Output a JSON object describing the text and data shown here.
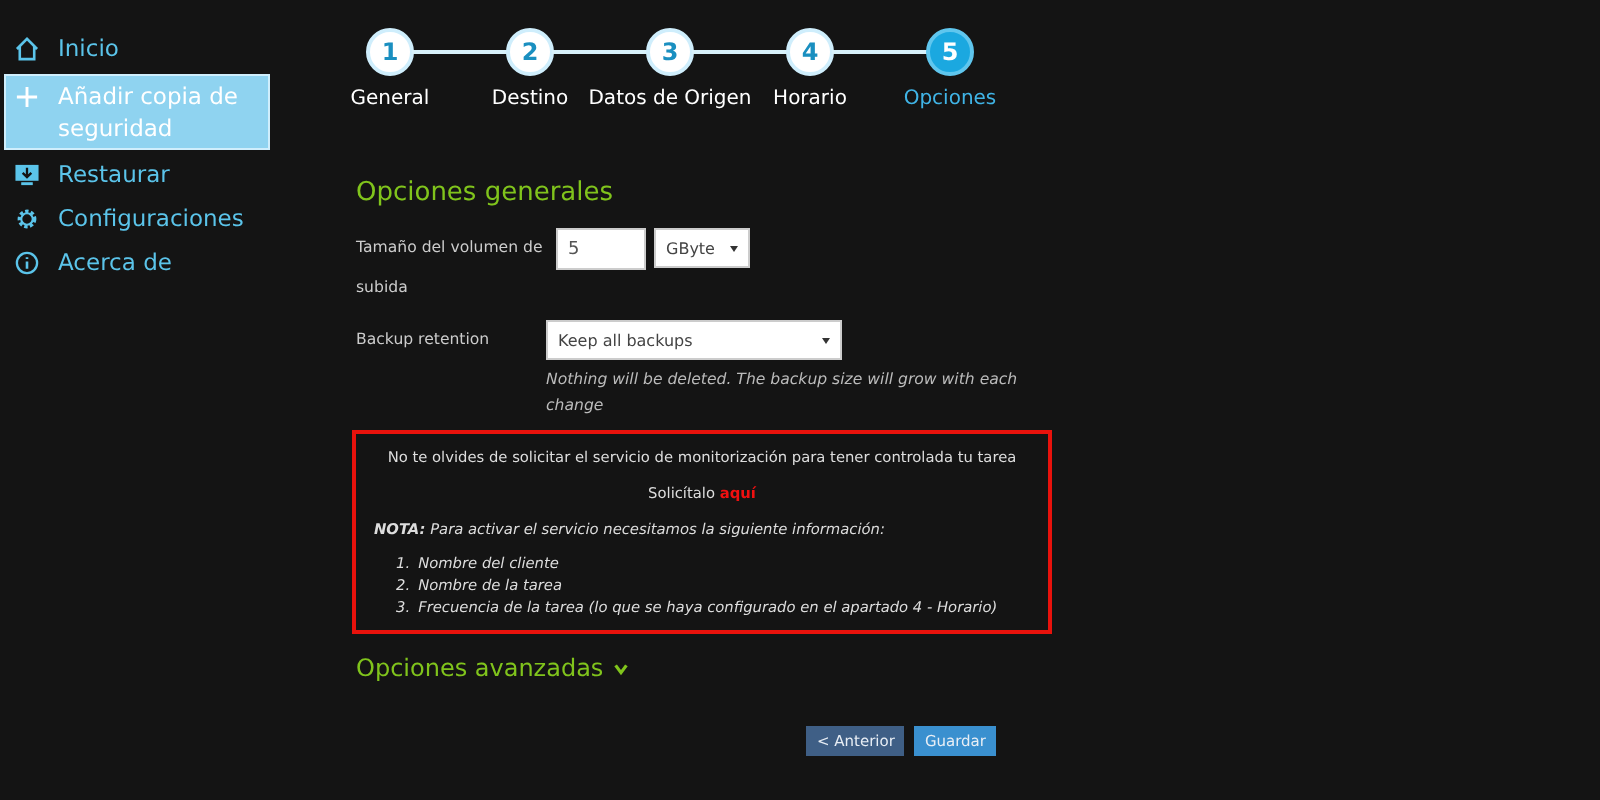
{
  "sidebar": {
    "items": [
      {
        "label": "Inicio",
        "selected": false
      },
      {
        "label": "Añadir copia de seguridad",
        "selected": true
      },
      {
        "label": "Restaurar",
        "selected": false
      },
      {
        "label": "Configuraciones",
        "selected": false
      },
      {
        "label": "Acerca de",
        "selected": false
      }
    ]
  },
  "steps": [
    {
      "number": "1",
      "label": "General",
      "selected": false
    },
    {
      "number": "2",
      "label": "Destino",
      "selected": false
    },
    {
      "number": "3",
      "label": "Datos de Origen",
      "selected": false
    },
    {
      "number": "4",
      "label": "Horario",
      "selected": false
    },
    {
      "number": "5",
      "label": "Opciones",
      "selected": true
    }
  ],
  "general": {
    "title": "Opciones generales",
    "volume": {
      "label": "Tamaño del volumen de subida",
      "value": "5",
      "unit": "GByte"
    },
    "retention": {
      "label": "Backup retention",
      "value": "Keep all backups",
      "hint": "Nothing will be deleted. The backup size will grow with each change"
    }
  },
  "notice": {
    "message": "No te olvides de solicitar el servicio de monitorización para tener controlada tu tarea",
    "request_text": "Solicítalo",
    "request_link": "aquí",
    "note": "**NOTA:** Para activar el servicio necesitamos la siguiente información:",
    "items": [
      {
        "number": "1.",
        "text": "Nombre del cliente"
      },
      {
        "number": "2.",
        "text": "Nombre de la tarea"
      },
      {
        "number": "3.",
        "text": "Frecuencia de la tarea (lo que se haya configurado en el apartado 4 - Horario)"
      }
    ]
  },
  "advanced": {
    "title": "Opciones avanzadas",
    "expanded": false
  },
  "buttons": {
    "back": "< Anterior",
    "save": "Guardar"
  }
}
